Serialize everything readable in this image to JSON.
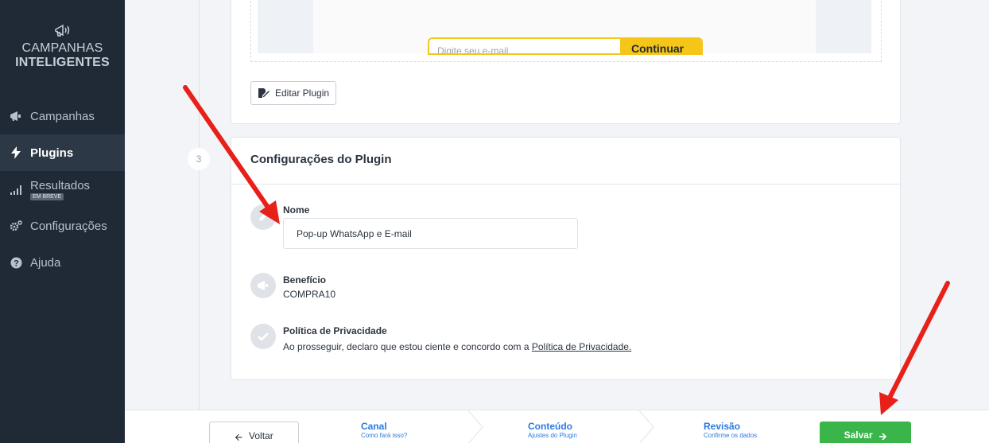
{
  "sidebar": {
    "logo_line1": "CAMPANHAS",
    "logo_line2": "INTELIGENTES",
    "items": [
      {
        "label": "Campanhas",
        "icon": "megaphone-icon"
      },
      {
        "label": "Plugins",
        "icon": "lightning-icon",
        "active": true
      },
      {
        "label": "Resultados",
        "icon": "bar-chart-icon",
        "badge": "EM BREVE"
      },
      {
        "label": "Configurações",
        "icon": "gears-icon"
      },
      {
        "label": "Ajuda",
        "icon": "help-icon"
      }
    ]
  },
  "preview": {
    "input_placeholder": "Digite seu e-mail",
    "button_label": "Continuar"
  },
  "card2": {
    "edit_label": "Editar Plugin"
  },
  "step3": {
    "number": "3",
    "title": "Configurações do Plugin",
    "name_label": "Nome",
    "name_value": "Pop-up WhatsApp e E-mail",
    "benefit_label": "Benefício",
    "benefit_value": "COMPRA10",
    "privacy_label": "Política de Privacidade",
    "privacy_text": "Ao prosseguir, declaro que estou ciente e concordo com a",
    "privacy_link": "Política de Privacidade."
  },
  "bottombar": {
    "back_label": "Voltar",
    "steps": [
      {
        "title": "Canal",
        "subtitle": "Como fará isso?"
      },
      {
        "title": "Conteúdo",
        "subtitle": "Ajustes do Plugin"
      },
      {
        "title": "Revisão",
        "subtitle": "Confirme os dados"
      }
    ],
    "save_label": "Salvar"
  },
  "colors": {
    "sidebar_bg": "#1f2a36",
    "accent_blue": "#2a7ae2",
    "save_green": "#3ab54a",
    "preview_yellow": "#f5c518",
    "annotation_red": "#e8201a"
  }
}
